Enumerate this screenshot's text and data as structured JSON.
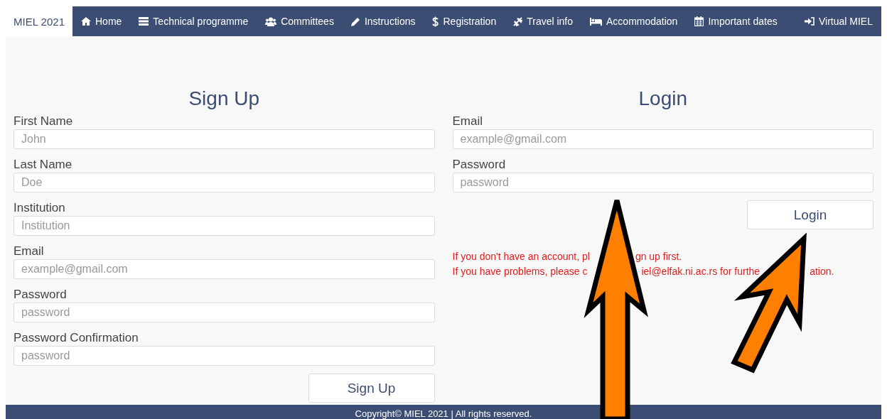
{
  "nav": {
    "brand": {
      "label": "MIEL 2021",
      "selected": true
    },
    "items": [
      {
        "label": "Home",
        "selected": false
      },
      {
        "label": "Technical programme",
        "selected": false
      },
      {
        "label": "Committees",
        "selected": false
      },
      {
        "label": "Instructions",
        "selected": false
      },
      {
        "label": "Registration",
        "selected": false
      },
      {
        "label": "Travel info",
        "selected": false
      },
      {
        "label": "Accommodation",
        "selected": false
      },
      {
        "label": "Important dates",
        "selected": false
      }
    ],
    "right_item": {
      "label": "Virtual MIEL",
      "selected": false
    }
  },
  "signup": {
    "title": "Sign Up",
    "fields": [
      {
        "label": "First Name",
        "placeholder": "John"
      },
      {
        "label": "Last Name",
        "placeholder": "Doe"
      },
      {
        "label": "Institution",
        "placeholder": "Institution"
      },
      {
        "label": "Email",
        "placeholder": "example@gmail.com"
      },
      {
        "label": "Password",
        "placeholder": "password"
      },
      {
        "label": "Password Confirmation",
        "placeholder": "password"
      }
    ],
    "button": "Sign Up"
  },
  "login": {
    "title": "Login",
    "fields": [
      {
        "label": "Email",
        "placeholder": "example@gmail.com"
      },
      {
        "label": "Password",
        "placeholder": "password"
      }
    ],
    "button": "Login",
    "notice_lines": [
      [
        "If you don't have an account, pl",
        "gn up first."
      ],
      [
        "If you have problems, please c",
        "iel@elfak.ni.ac.rs for furthe",
        "ation."
      ]
    ]
  },
  "footer": "Copyright© MIEL 2021 | All rights reserved."
}
